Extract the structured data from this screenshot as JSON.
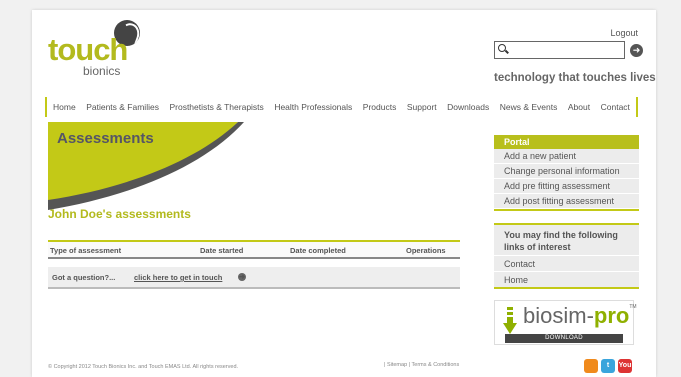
{
  "logo": {
    "word": "touch",
    "sub": "bionics"
  },
  "header": {
    "logout": "Logout",
    "search_placeholder": "",
    "search_go": "➜",
    "tagline": "technology that touches lives"
  },
  "nav": [
    "Home",
    "Patients & Families",
    "Prosthetists & Therapists",
    "Health Professionals",
    "Products",
    "Support",
    "Downloads",
    "News & Events",
    "About",
    "Contact"
  ],
  "main": {
    "banner_title": "Assessments",
    "section_title": "John Doe's assessments",
    "table_headers": [
      "Type of assessment",
      "Date started",
      "Date completed",
      "Operations"
    ],
    "question_prefix": "Got a question?...",
    "question_link": "click here to get in touch",
    "question_arrow": "➜"
  },
  "sidebar": {
    "portal": {
      "title": "Portal",
      "items": [
        "Add a new patient",
        "Change personal information",
        "Add pre fitting assessment",
        "Add post fitting assessment"
      ]
    },
    "interest": {
      "title": "You may find the following links of interest",
      "items": [
        "Contact",
        "Home"
      ]
    }
  },
  "biosim": {
    "word": "biosim-",
    "pro": "pro",
    "tm": "TM",
    "download": "DOWNLOAD"
  },
  "footer": {
    "copyright": "© Copyright 2012 Touch Bionics Inc. and Touch EMAS Ltd. All rights reserved.",
    "links": "|  Sitemap  |  Terms & Conditions"
  },
  "social": [
    {
      "name": "rss-icon",
      "label": "",
      "color": "#f08a1c"
    },
    {
      "name": "twitter-icon",
      "label": "t",
      "color": "#3aa5dc"
    },
    {
      "name": "youtube-icon",
      "label": "You",
      "color": "#d33"
    }
  ],
  "colors": {
    "accent": "#b8bf1c",
    "text": "#555555"
  }
}
